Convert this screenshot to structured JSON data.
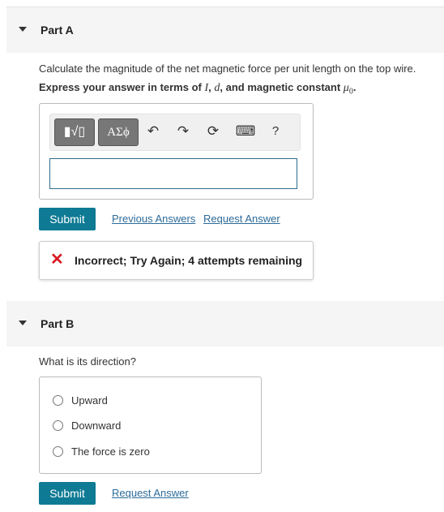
{
  "partA": {
    "title": "Part A",
    "question": "Calculate the magnitude of the net magnetic force per unit length on the top wire.",
    "instruction_prefix": "Express your answer in terms of ",
    "var_I": "I",
    "comma1": ", ",
    "var_d": "d",
    "instruction_mid": ", and magnetic constant ",
    "var_mu": "μ",
    "var_mu_sub": "0",
    "instruction_end": ".",
    "toolbar": {
      "template_button": "▮√▯",
      "symbols_button": "ΑΣϕ",
      "undo_icon": "↶",
      "redo_icon": "↷",
      "reset_icon": "⟳",
      "keyboard_icon": "⌨",
      "help_label": "?"
    },
    "answer_value": "",
    "submit_label": "Submit",
    "previous_answers_label": "Previous Answers",
    "request_answer_label": "Request Answer",
    "feedback": {
      "icon": "✕",
      "message": "Incorrect; Try Again; 4 attempts remaining"
    }
  },
  "partB": {
    "title": "Part B",
    "question": "What is its direction?",
    "options": [
      "Upward",
      "Downward",
      "The force is zero"
    ],
    "submit_label": "Submit",
    "request_answer_label": "Request Answer"
  },
  "colors": {
    "submit_bg": "#0e7a94",
    "link": "#2c6b9a",
    "error": "#d81b24",
    "header_bg": "#f5f5f5"
  }
}
